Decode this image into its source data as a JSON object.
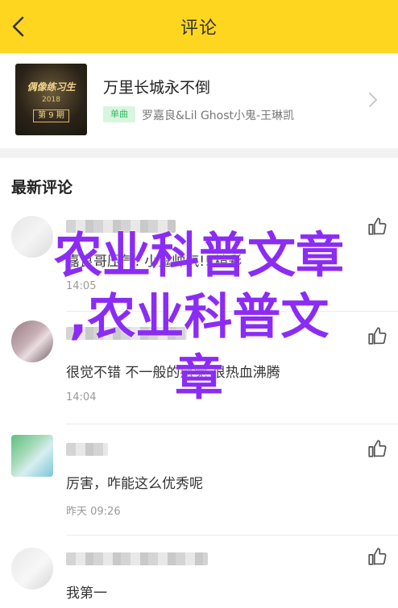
{
  "header": {
    "title": "评论"
  },
  "song": {
    "title": "万里长城永不倒",
    "badge": "单曲",
    "artists": "罗嘉良&Lil Ghost小鬼-王琳凯",
    "cover_top_text": "偶像练习生",
    "cover_year": "2018",
    "cover_episode": "第 9 期"
  },
  "comments": {
    "section_title": "最新评论",
    "items": [
      {
        "text": "嘉良哥压气! 小鬼帅气!! 精彩",
        "time": "14:05"
      },
      {
        "text": "很觉不错 不一般的感觉 很热血沸腾",
        "time": "14:04"
      },
      {
        "text": "厉害，咋能这么优秀呢",
        "time": "昨天 09:26"
      },
      {
        "text": "我第一",
        "time": ""
      }
    ]
  },
  "watermark": {
    "line1": "农业科普文章",
    "line2": ",农业科普文",
    "line3": "章"
  },
  "colors": {
    "accent": "#ffd61f",
    "badge_text": "#2fbf5c",
    "badge_bg": "#d9f5e0",
    "watermark": "#8b2cf5"
  },
  "icons": {
    "back": "chevron-left-icon",
    "forward": "chevron-right-icon",
    "like": "thumbs-up-icon"
  }
}
